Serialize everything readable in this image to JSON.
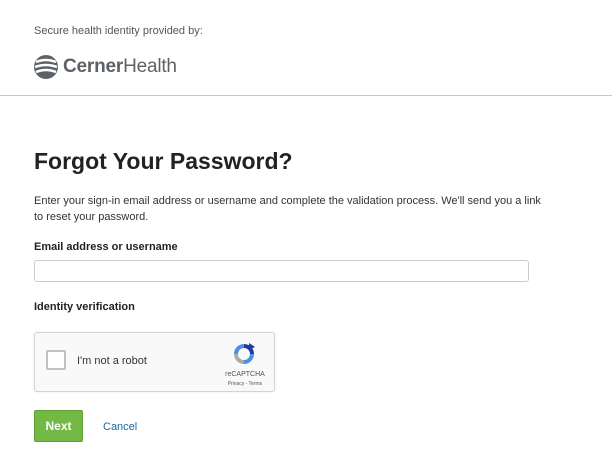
{
  "header": {
    "provided_by": "Secure health identity provided by:",
    "logo_text_bold": "Cerner",
    "logo_text_light": "Health"
  },
  "main": {
    "title": "Forgot Your Password?",
    "description": "Enter your sign-in email address or username and complete the validation process. We'll send you a link to reset your password.",
    "email_label": "Email address or username",
    "email_value": "",
    "email_placeholder": "",
    "identity_label": "Identity verification"
  },
  "recaptcha": {
    "checkbox_label": "I'm not a robot",
    "brand": "reCAPTCHA",
    "links": "Privacy - Terms"
  },
  "actions": {
    "next_label": "Next",
    "cancel_label": "Cancel"
  },
  "colors": {
    "next_button": "#73b946",
    "link": "#1b6aa5",
    "logo": "#5d6268"
  }
}
